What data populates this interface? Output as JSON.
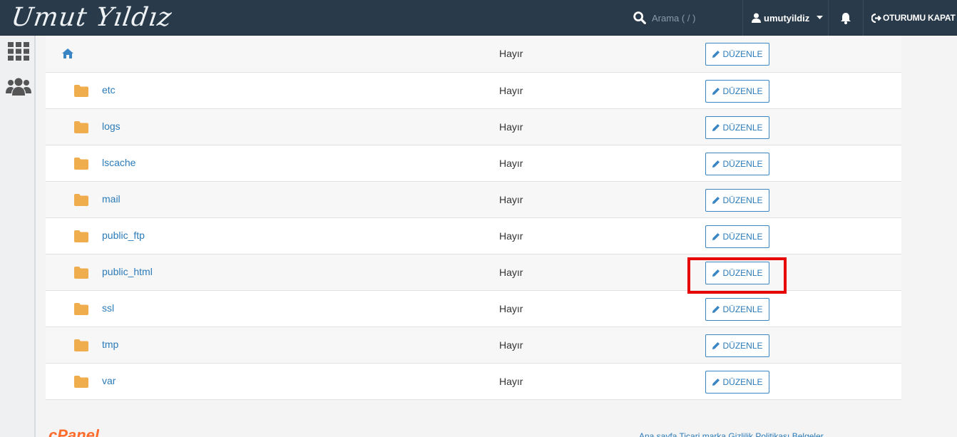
{
  "brand": {
    "logo_text": "Umut Yıldız"
  },
  "header": {
    "search_placeholder": "Arama ( / )",
    "username": "umutyildiz",
    "logout_label": "OTURUMU KAPAT"
  },
  "sidebar": {
    "items": [
      {
        "icon": "grid-icon"
      },
      {
        "icon": "users-icon"
      }
    ]
  },
  "directories": {
    "edit_label": "DÜZENLE",
    "rows": [
      {
        "name": "",
        "is_home": true,
        "status": "Hayır"
      },
      {
        "name": "etc",
        "status": "Hayır"
      },
      {
        "name": "logs",
        "status": "Hayır"
      },
      {
        "name": "lscache",
        "status": "Hayır"
      },
      {
        "name": "mail",
        "status": "Hayır"
      },
      {
        "name": "public_ftp",
        "status": "Hayır"
      },
      {
        "name": "public_html",
        "status": "Hayır",
        "highlighted": true
      },
      {
        "name": "ssl",
        "status": "Hayır"
      },
      {
        "name": "tmp",
        "status": "Hayır"
      },
      {
        "name": "var",
        "status": "Hayır"
      }
    ]
  },
  "colors": {
    "topbar": "#293a4a",
    "link": "#2b7bb9",
    "folder": "#f0ad4e",
    "highlight": "#e60000",
    "cpanel_orange": "#ff6c2c"
  },
  "footer": {
    "cpanel_logo": "cPanel",
    "links_text": "Ana sayfa   Ticari marka   Gizlilik Politikası   Belgeler"
  }
}
